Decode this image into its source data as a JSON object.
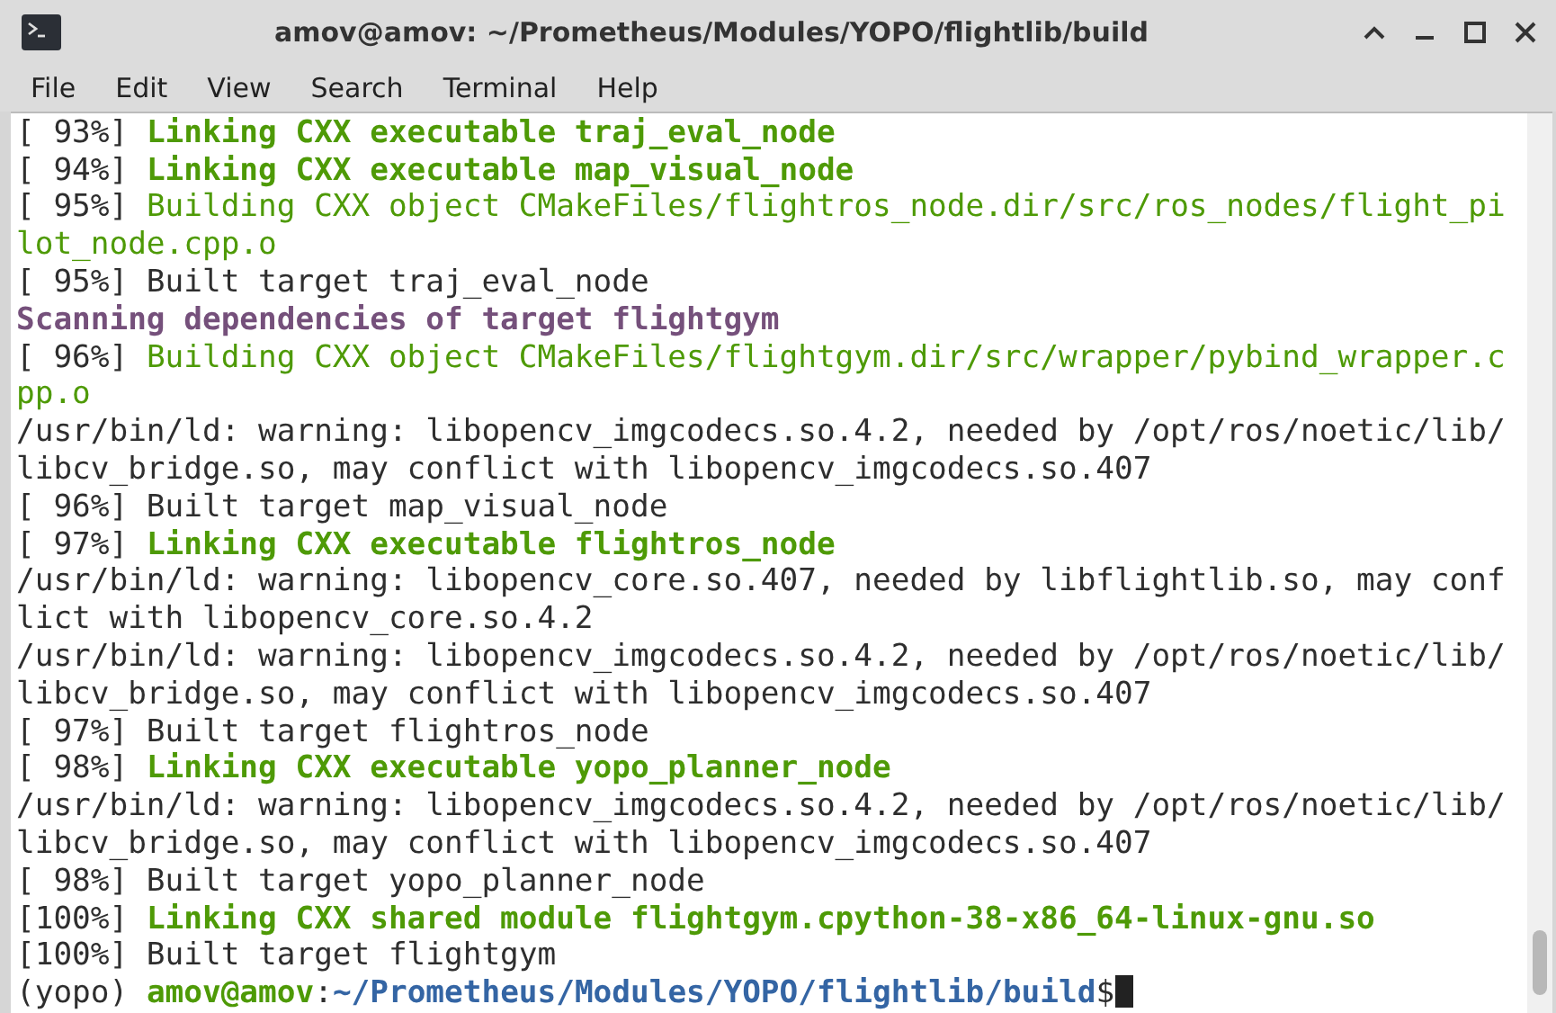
{
  "window": {
    "title": "amov@amov: ~/Prometheus/Modules/YOPO/flightlib/build"
  },
  "menu": [
    "File",
    "Edit",
    "View",
    "Search",
    "Terminal",
    "Help"
  ],
  "lines": [
    [
      {
        "kind": "plain",
        "text": "[ 93%] "
      },
      {
        "kind": "green_bold",
        "text": "Linking CXX executable traj_eval_node"
      }
    ],
    [
      {
        "kind": "plain",
        "text": "[ 94%] "
      },
      {
        "kind": "green_bold",
        "text": "Linking CXX executable map_visual_node"
      }
    ],
    [
      {
        "kind": "plain",
        "text": "[ 95%] "
      },
      {
        "kind": "green",
        "text": "Building CXX object CMakeFiles/flightros_node.dir/src/ros_nodes/flight_pi"
      }
    ],
    [
      {
        "kind": "green",
        "text": "lot_node.cpp.o"
      }
    ],
    [
      {
        "kind": "plain",
        "text": "[ 95%] Built target traj_eval_node"
      }
    ],
    [
      {
        "kind": "purple_bold",
        "text": "Scanning dependencies of target flightgym"
      }
    ],
    [
      {
        "kind": "plain",
        "text": "[ 96%] "
      },
      {
        "kind": "green",
        "text": "Building CXX object CMakeFiles/flightgym.dir/src/wrapper/pybind_wrapper.c"
      }
    ],
    [
      {
        "kind": "green",
        "text": "pp.o"
      }
    ],
    [
      {
        "kind": "plain",
        "text": "/usr/bin/ld: warning: libopencv_imgcodecs.so.4.2, needed by /opt/ros/noetic/lib/"
      }
    ],
    [
      {
        "kind": "plain",
        "text": "libcv_bridge.so, may conflict with libopencv_imgcodecs.so.407"
      }
    ],
    [
      {
        "kind": "plain",
        "text": "[ 96%] Built target map_visual_node"
      }
    ],
    [
      {
        "kind": "plain",
        "text": "[ 97%] "
      },
      {
        "kind": "green_bold",
        "text": "Linking CXX executable flightros_node"
      }
    ],
    [
      {
        "kind": "plain",
        "text": "/usr/bin/ld: warning: libopencv_core.so.407, needed by libflightlib.so, may conf"
      }
    ],
    [
      {
        "kind": "plain",
        "text": "lict with libopencv_core.so.4.2"
      }
    ],
    [
      {
        "kind": "plain",
        "text": "/usr/bin/ld: warning: libopencv_imgcodecs.so.4.2, needed by /opt/ros/noetic/lib/"
      }
    ],
    [
      {
        "kind": "plain",
        "text": "libcv_bridge.so, may conflict with libopencv_imgcodecs.so.407"
      }
    ],
    [
      {
        "kind": "plain",
        "text": "[ 97%] Built target flightros_node"
      }
    ],
    [
      {
        "kind": "plain",
        "text": "[ 98%] "
      },
      {
        "kind": "green_bold",
        "text": "Linking CXX executable yopo_planner_node"
      }
    ],
    [
      {
        "kind": "plain",
        "text": "/usr/bin/ld: warning: libopencv_imgcodecs.so.4.2, needed by /opt/ros/noetic/lib/"
      }
    ],
    [
      {
        "kind": "plain",
        "text": "libcv_bridge.so, may conflict with libopencv_imgcodecs.so.407"
      }
    ],
    [
      {
        "kind": "plain",
        "text": "[ 98%] Built target yopo_planner_node"
      }
    ],
    [
      {
        "kind": "plain",
        "text": "[100%] "
      },
      {
        "kind": "green_bold",
        "text": "Linking CXX shared module flightgym.cpython-38-x86_64-linux-gnu.so"
      }
    ],
    [
      {
        "kind": "plain",
        "text": "[100%] Built target flightgym"
      }
    ]
  ],
  "prompt": {
    "env": "(yopo) ",
    "user": "amov@amov",
    "separator": ":",
    "path": "~/Prometheus/Modules/YOPO/flightlib/build",
    "symbol": "$"
  }
}
